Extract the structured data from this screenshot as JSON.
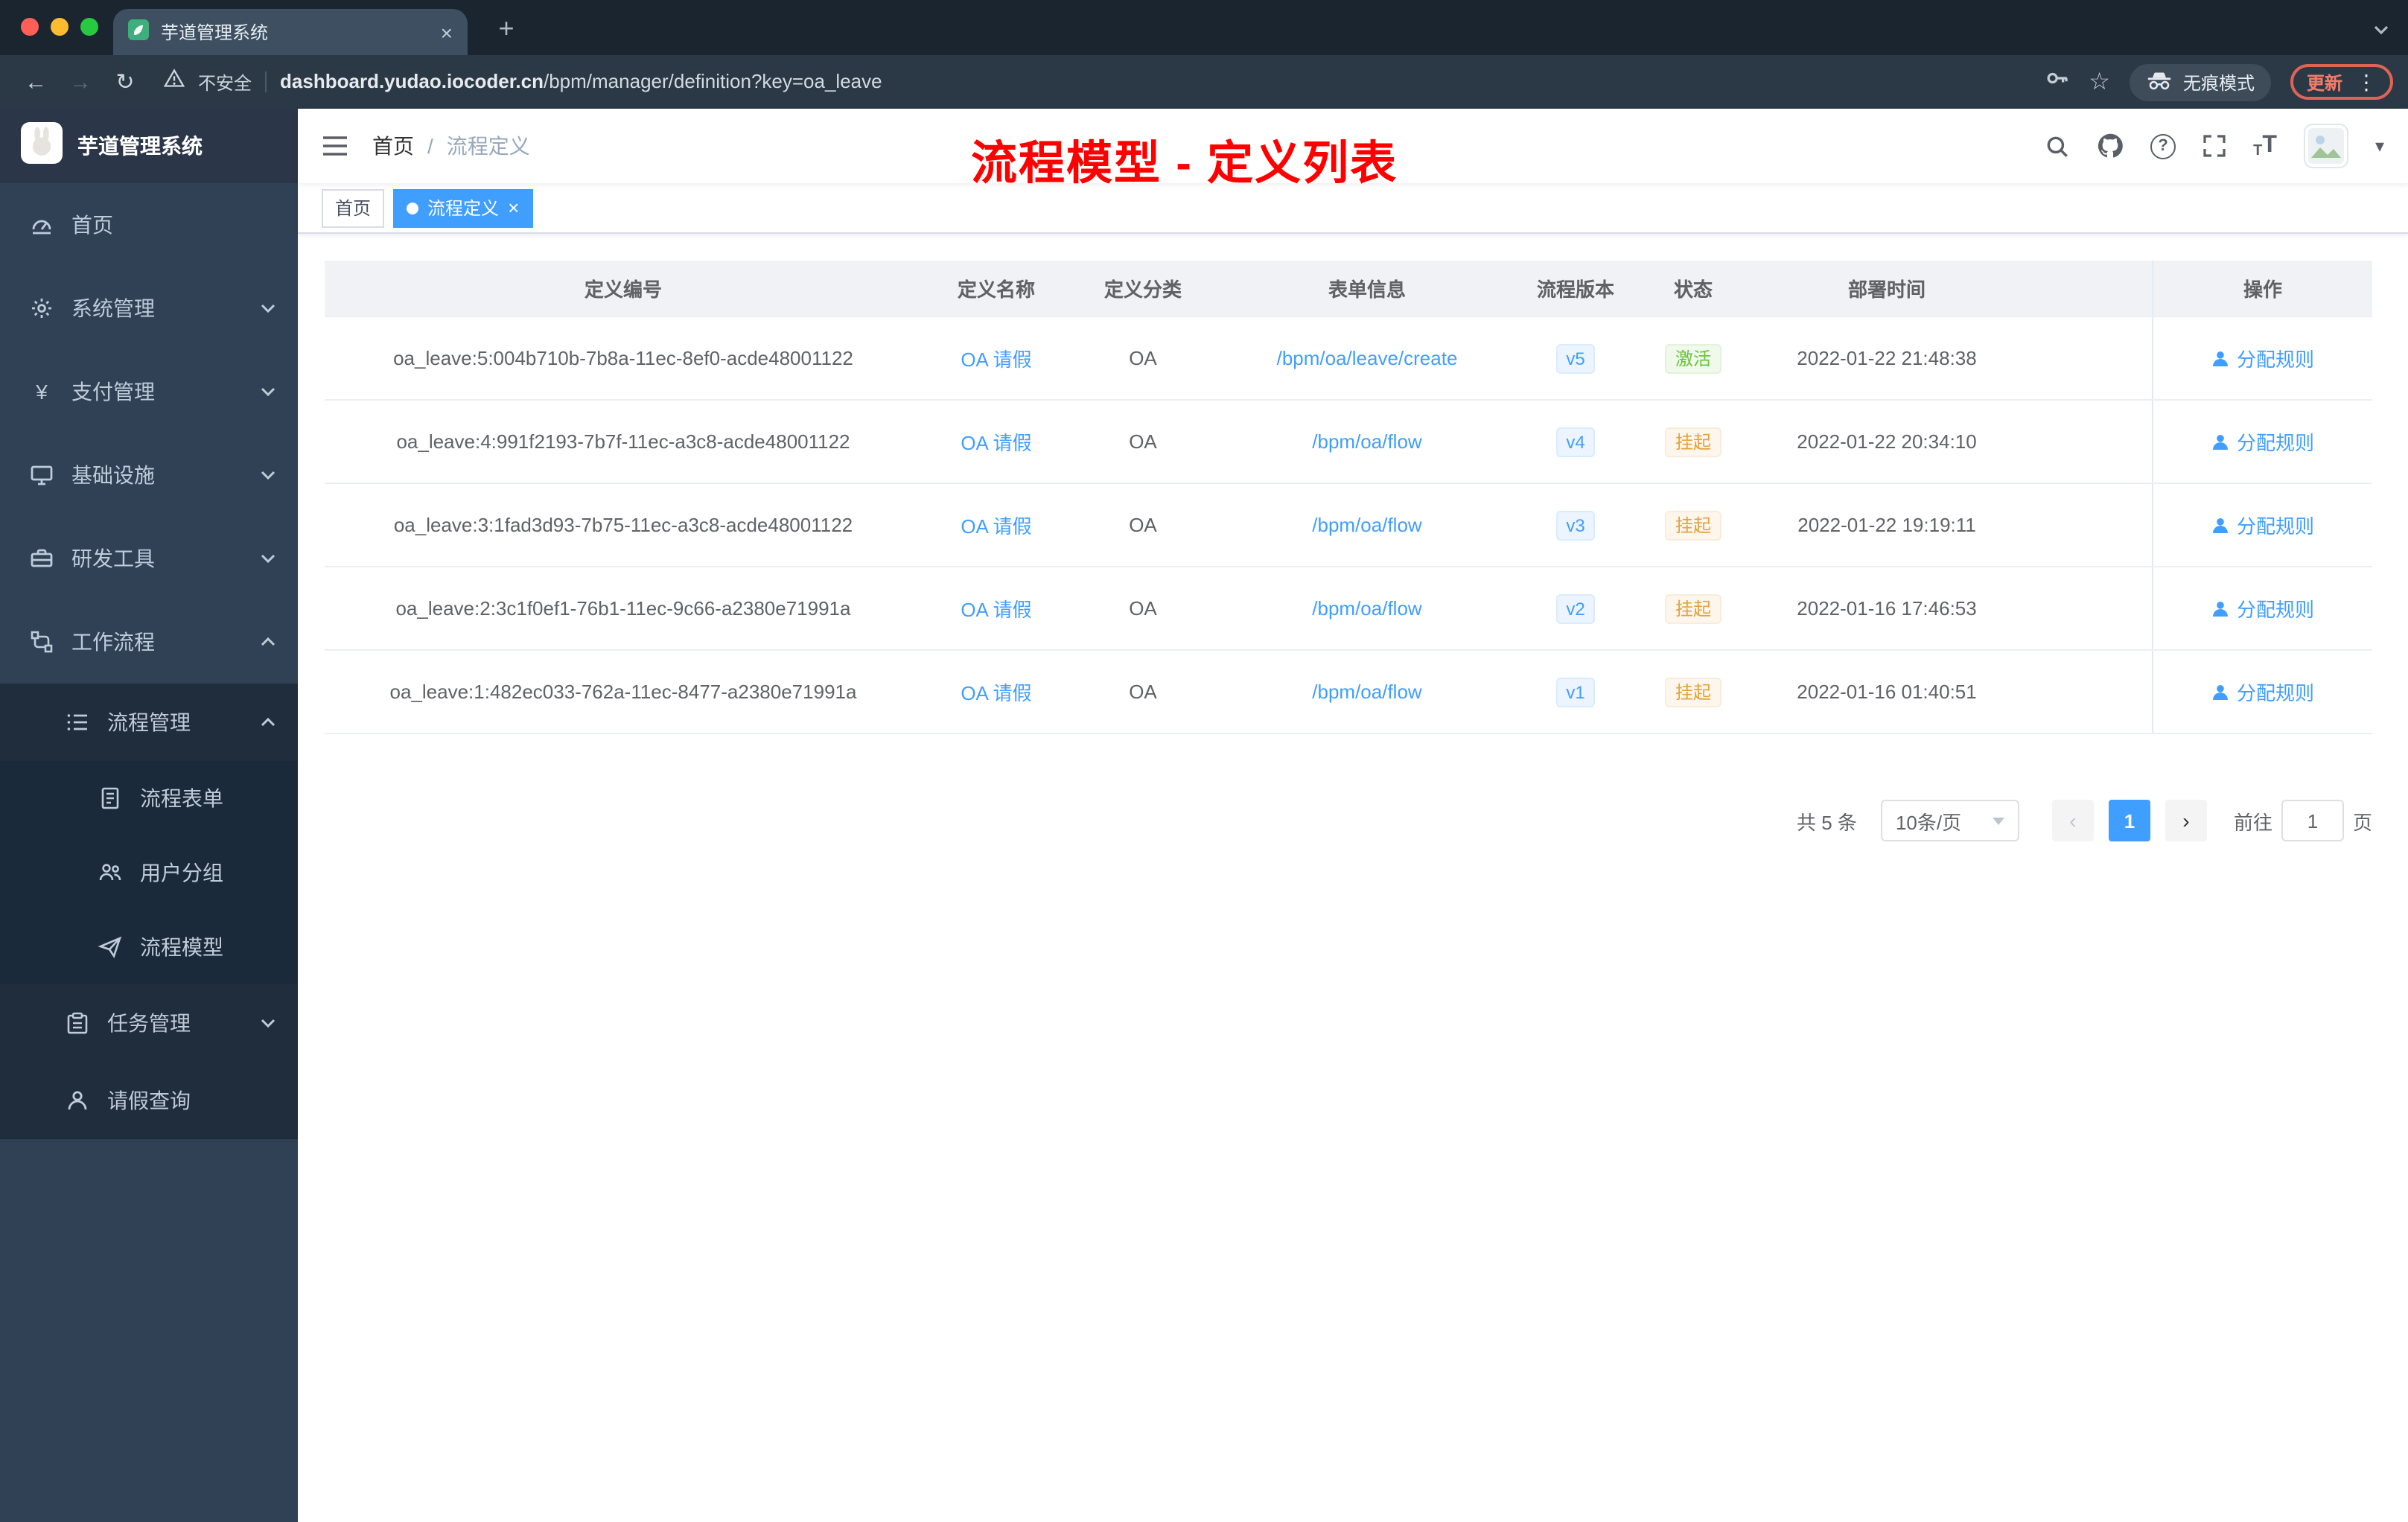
{
  "colors": {
    "accent": "#409eff",
    "success": "#67c23a",
    "warning": "#e6a23c",
    "annotation_red": "#ff0000",
    "sidebar_bg": "#304156",
    "submenu_bg": "#1f2d3d"
  },
  "browser": {
    "tab_title": "芋道管理系统",
    "security_label": "不安全",
    "url_domain": "dashboard.yudao.iocoder.cn",
    "url_path": "/bpm/manager/definition?key=oa_leave",
    "incognito_label": "无痕模式",
    "update_label": "更新",
    "icons": [
      "back-icon",
      "forward-icon",
      "reload-icon",
      "warning-icon",
      "key-icon",
      "star-icon",
      "incognito-icon",
      "more-icon",
      "new-tab-icon",
      "close-icon",
      "tab-search-icon"
    ]
  },
  "sidebar": {
    "logo_title": "芋道管理系统",
    "items": [
      {
        "label": "首页",
        "icon": "dashboard-icon"
      },
      {
        "label": "系统管理",
        "icon": "gear-icon",
        "expandable": true
      },
      {
        "label": "支付管理",
        "icon": "yen-icon",
        "expandable": true
      },
      {
        "label": "基础设施",
        "icon": "monitor-icon",
        "expandable": true
      },
      {
        "label": "研发工具",
        "icon": "toolbox-icon",
        "expandable": true
      },
      {
        "label": "工作流程",
        "icon": "workflow-icon",
        "expanded": true,
        "children": [
          {
            "label": "流程管理",
            "icon": "list-icon",
            "expanded": true,
            "children": [
              {
                "label": "流程表单",
                "icon": "form-icon"
              },
              {
                "label": "用户分组",
                "icon": "user-group-icon"
              },
              {
                "label": "流程模型",
                "icon": "paper-plane-icon"
              }
            ]
          },
          {
            "label": "任务管理",
            "icon": "clipboard-icon",
            "expandable": true
          },
          {
            "label": "请假查询",
            "icon": "person-icon"
          }
        ]
      }
    ]
  },
  "header": {
    "breadcrumb": [
      "首页",
      "流程定义"
    ],
    "breadcrumb_separator": "/",
    "annotation": "流程模型 - 定义列表",
    "icons": [
      "search-icon",
      "github-icon",
      "help-icon",
      "fullscreen-icon",
      "font-size-icon",
      "avatar",
      "caret-down-icon"
    ]
  },
  "tags": [
    {
      "label": "首页",
      "active": false
    },
    {
      "label": "流程定义",
      "active": true,
      "closable": true
    }
  ],
  "table": {
    "columns": [
      "定义编号",
      "定义名称",
      "定义分类",
      "表单信息",
      "流程版本",
      "状态",
      "部署时间",
      "操作"
    ],
    "rows": [
      {
        "id": "oa_leave:5:004b710b-7b8a-11ec-8ef0-acde48001122",
        "name": "OA 请假",
        "category": "OA",
        "form": "/bpm/oa/leave/create",
        "version": "v5",
        "status": "激活",
        "status_type": "success",
        "time": "2022-01-22 21:48:38",
        "action": "分配规则"
      },
      {
        "id": "oa_leave:4:991f2193-7b7f-11ec-a3c8-acde48001122",
        "name": "OA 请假",
        "category": "OA",
        "form": "/bpm/oa/flow",
        "version": "v4",
        "status": "挂起",
        "status_type": "warning",
        "time": "2022-01-22 20:34:10",
        "action": "分配规则"
      },
      {
        "id": "oa_leave:3:1fad3d93-7b75-11ec-a3c8-acde48001122",
        "name": "OA 请假",
        "category": "OA",
        "form": "/bpm/oa/flow",
        "version": "v3",
        "status": "挂起",
        "status_type": "warning",
        "time": "2022-01-22 19:19:11",
        "action": "分配规则"
      },
      {
        "id": "oa_leave:2:3c1f0ef1-76b1-11ec-9c66-a2380e71991a",
        "name": "OA 请假",
        "category": "OA",
        "form": "/bpm/oa/flow",
        "version": "v2",
        "status": "挂起",
        "status_type": "warning",
        "time": "2022-01-16 17:46:53",
        "action": "分配规则"
      },
      {
        "id": "oa_leave:1:482ec033-762a-11ec-8477-a2380e71991a",
        "name": "OA 请假",
        "category": "OA",
        "form": "/bpm/oa/flow",
        "version": "v1",
        "status": "挂起",
        "status_type": "warning",
        "time": "2022-01-16 01:40:51",
        "action": "分配规则"
      }
    ]
  },
  "pagination": {
    "total": "共 5 条",
    "page_size": "10条/页",
    "current": "1",
    "goto_prefix": "前往",
    "goto_value": "1",
    "goto_suffix": "页"
  }
}
